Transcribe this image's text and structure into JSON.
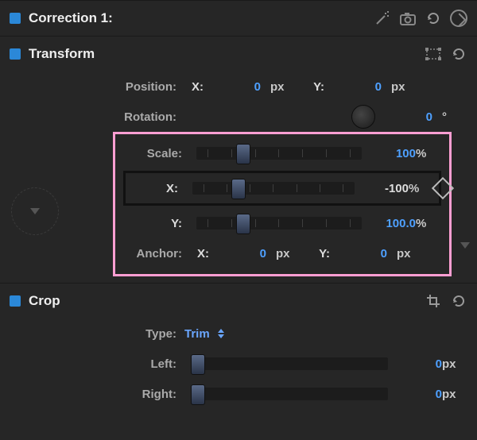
{
  "correction": {
    "title": "Correction 1:"
  },
  "transform": {
    "title": "Transform",
    "position": {
      "label": "Position:",
      "xLabel": "X:",
      "xValue": "0",
      "xUnit": "px",
      "yLabel": "Y:",
      "yValue": "0",
      "yUnit": "px"
    },
    "rotation": {
      "label": "Rotation:",
      "value": "0",
      "unit": "°"
    },
    "scale": {
      "label": "Scale:",
      "value": "100",
      "unit": "%"
    },
    "scaleX": {
      "label": "X:",
      "value": "-100",
      "unit": "%"
    },
    "scaleY": {
      "label": "Y:",
      "value": "100.0",
      "unit": "%"
    },
    "anchor": {
      "label": "Anchor:",
      "xLabel": "X:",
      "xValue": "0",
      "xUnit": "px",
      "yLabel": "Y:",
      "yValue": "0",
      "yUnit": "px"
    }
  },
  "crop": {
    "title": "Crop",
    "type": {
      "label": "Type:",
      "value": "Trim"
    },
    "left": {
      "label": "Left:",
      "value": "0",
      "unit": "px"
    },
    "right": {
      "label": "Right:",
      "value": "0",
      "unit": "px"
    }
  }
}
